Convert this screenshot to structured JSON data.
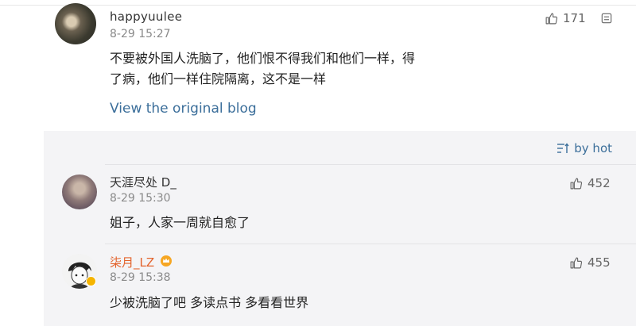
{
  "main_comment": {
    "username": "happyuulee",
    "time": "8-29 15:27",
    "likes": "171",
    "text_line1": "不要被外国人洗脑了，他们恨不得我们和他们一样，得",
    "text_line2": "了病，他们一样住院隔离，这不是一样",
    "link": "View the original blog"
  },
  "replies_panel": {
    "sort_label": "by hot",
    "replies": [
      {
        "username": "天涯尽处 D_",
        "time": "8-29 15:30",
        "text": "姐子，人家一周就自愈了",
        "likes": "452"
      },
      {
        "username": "柒月_LZ",
        "time": "8-29 15:38",
        "text": "少被洗脑了吧 多读点书 多看看世界",
        "likes": "455"
      }
    ]
  },
  "colors": {
    "link": "#3b6e9a",
    "vip_name": "#e3632c",
    "panel_bg": "#f4f4f6"
  }
}
